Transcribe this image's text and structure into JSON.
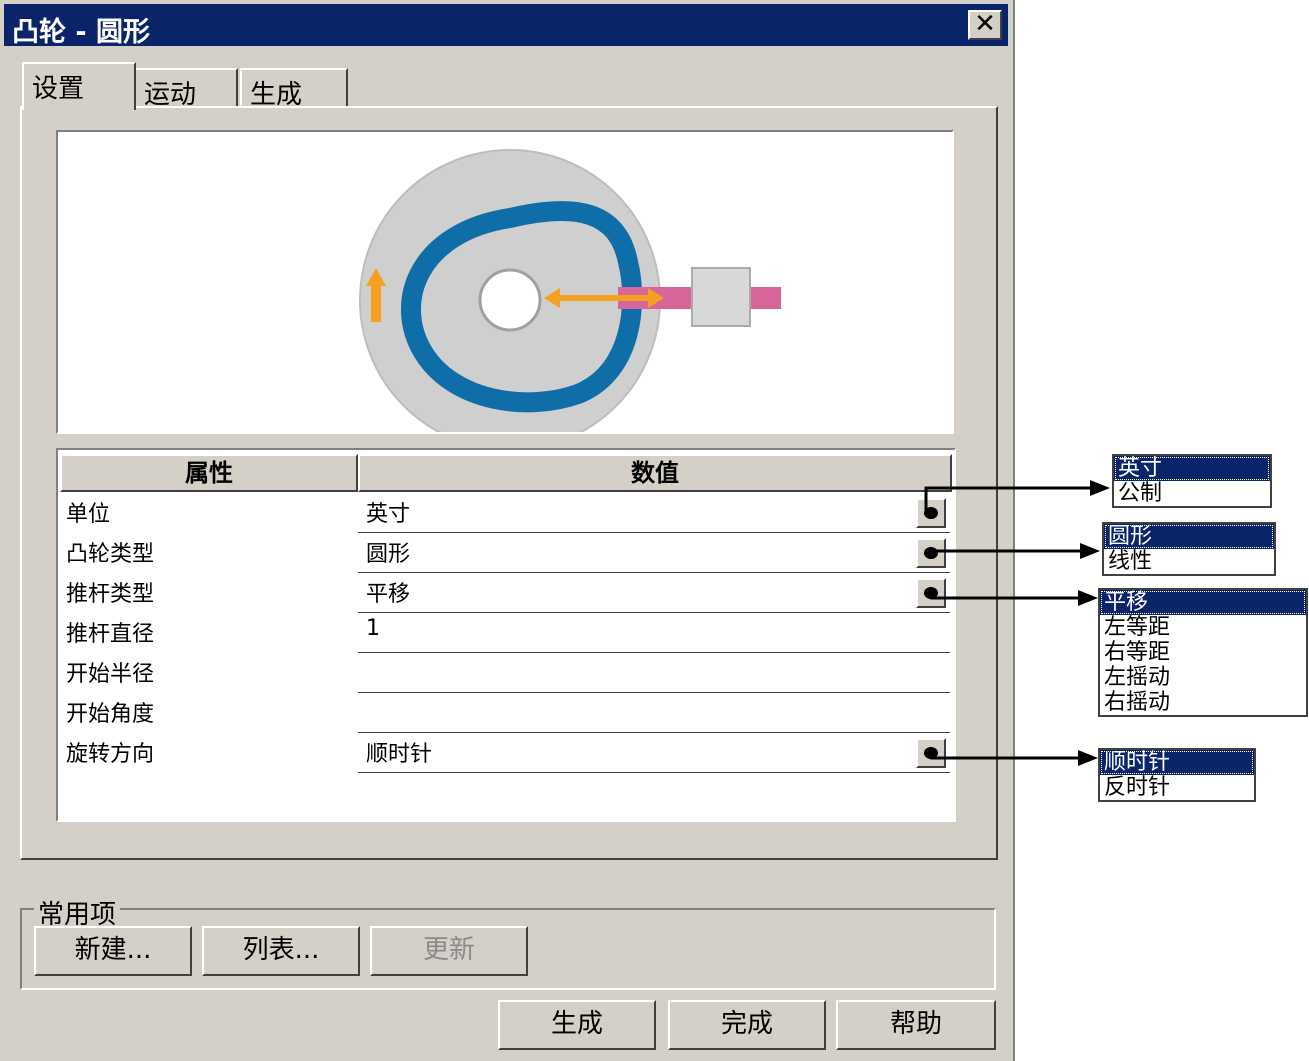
{
  "window": {
    "title": "凸轮 - 圆形",
    "close_glyph": "✕"
  },
  "tabs": [
    {
      "label": "设置",
      "active": true
    },
    {
      "label": "运动"
    },
    {
      "label": "生成"
    }
  ],
  "table": {
    "headers": [
      "属性",
      "数值"
    ],
    "rows": [
      {
        "name": "单位",
        "value": "英寸",
        "has_dropdown": true
      },
      {
        "name": "凸轮类型",
        "value": "圆形",
        "has_dropdown": true
      },
      {
        "name": "推杆类型",
        "value": "平移",
        "has_dropdown": true
      },
      {
        "name": "推杆直径",
        "value": "1"
      },
      {
        "name": "开始半径",
        "value": ""
      },
      {
        "name": "开始角度",
        "value": ""
      },
      {
        "name": "旋转方向",
        "value": "顺时针",
        "has_dropdown": true
      }
    ]
  },
  "common": {
    "label": "常用项",
    "new_button": "新建...",
    "list_button": "列表...",
    "update_button": "更新"
  },
  "footer": {
    "generate": "生成",
    "finish": "完成",
    "help": "帮助"
  },
  "dropdowns": {
    "units": [
      "英寸",
      "公制"
    ],
    "cam_type": [
      "圆形",
      "线性"
    ],
    "follower_type": [
      "平移",
      "左等距",
      "右等距",
      "左摇动",
      "右摇动"
    ],
    "rotation": [
      "顺时针",
      "反时针"
    ]
  },
  "colors": {
    "title_bar": "#0a246a",
    "cam_track": "#0f6ea8",
    "motion_arrow": "#f5a020",
    "follower": "#d9669a"
  }
}
